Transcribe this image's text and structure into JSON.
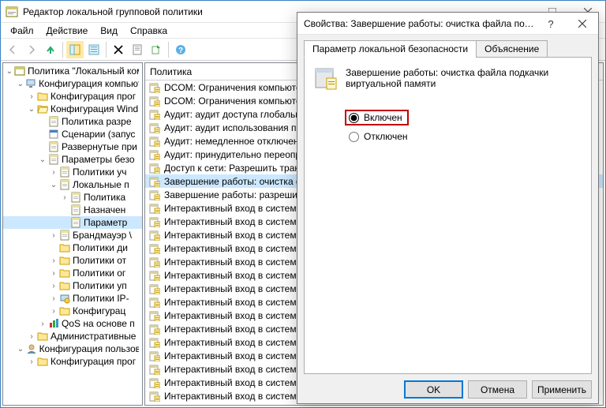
{
  "window": {
    "title": "Редактор локальной групповой политики"
  },
  "menu": {
    "file": "Файл",
    "action": "Действие",
    "view": "Вид",
    "help": "Справка"
  },
  "tree": {
    "root": "Политика \"Локальный ком",
    "computer_config": "Конфигурация компьют",
    "software_config": "Конфигурация прог",
    "windows_config": "Конфигурация Wind",
    "name_resolution": "Политика разре",
    "scripts": "Сценарии (запус",
    "deployed_printers": "Развернутые при",
    "security_settings": "Параметры безо",
    "account_policies": "Политики уч",
    "local_policies": "Локальные п",
    "audit_policy": "Политика",
    "user_rights": "Назначен",
    "security_options": "Параметр",
    "firewall": "Брандмауэр \\",
    "network_list": "Политики ди",
    "public_key": "Политики от",
    "software_restrict": "Политики ог",
    "appcontrol": "Политики уп",
    "ipsec": "Политики IP-",
    "advanced_audit": "Конфигурац",
    "qos": "QoS на основе п",
    "admin_templates": "Административные",
    "user_config": "Конфигурация пользов",
    "user_software": "Конфигурация прог"
  },
  "list": {
    "header": "Политика",
    "items": [
      "DCOM: Ограничения компьютер",
      "DCOM: Ограничения компьютер",
      "Аудит: аудит доступа глобальны",
      "Аудит: аудит использования пр",
      "Аудит: немедленное отключени",
      "Аудит: принудительно переопр",
      "Доступ к сети: Разрешить трансл",
      "Завершение работы: очистка фа",
      "Завершение работы: разрешить",
      "Интерактивный вход в систему: ",
      "Интерактивный вход в систему: з",
      "Интерактивный вход в систему: з",
      "Интерактивный вход в систему: к",
      "Интерактивный вход в систему: к",
      "Интерактивный вход в систему: н",
      "Интерактивный вход в систему: н",
      "Интерактивный вход в систему: н",
      "Интерактивный вход в систему: о",
      "Интерактивный вход в систему: п",
      "Интерактивный вход в систему: п",
      "Интерактивный вход в систему: п",
      "Интерактивный вход в систему: п",
      "Интерактивный вход в систему: т",
      "Интерактивный вход в систему: т"
    ],
    "selected_index": 7
  },
  "dialog": {
    "title": "Свойства: Завершение работы: очистка файла подкач...",
    "tab_security": "Параметр локальной безопасности",
    "tab_explain": "Объяснение",
    "policy_text": "Завершение работы: очистка файла подкачки виртуальной памяти",
    "radio_enabled": "Включен",
    "radio_disabled": "Отключен",
    "btn_ok": "OK",
    "btn_cancel": "Отмена",
    "btn_apply": "Применить"
  }
}
